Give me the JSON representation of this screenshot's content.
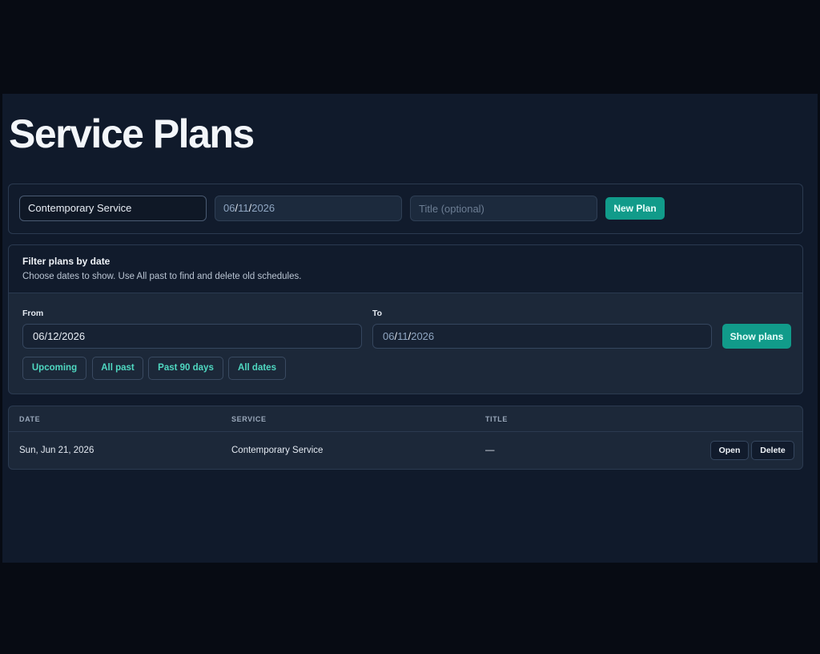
{
  "page": {
    "title": "Service Plans"
  },
  "create_bar": {
    "service_value": "Contemporary Service",
    "date": {
      "month": "06",
      "day": "11",
      "year": "2026"
    },
    "title_placeholder": "Title (optional)",
    "new_plan_label": "New Plan"
  },
  "filter": {
    "title": "Filter plans by date",
    "description": "Choose dates to show. Use All past to find and delete old schedules.",
    "from_label": "From",
    "from_value": "06/12/2026",
    "to_label": "To",
    "to_date": {
      "month": "06",
      "day": "11",
      "year": "2026"
    },
    "show_plans_label": "Show plans",
    "chips": [
      "Upcoming",
      "All past",
      "Past 90 days",
      "All dates"
    ]
  },
  "table": {
    "columns": [
      "DATE",
      "SERVICE",
      "TITLE"
    ],
    "rows": [
      {
        "date": "Sun, Jun 21, 2026",
        "service": "Contemporary Service",
        "title": "—",
        "open_label": "Open",
        "delete_label": "Delete"
      }
    ]
  },
  "colors": {
    "accent": "#119b8a",
    "chip_text": "#4fd8c1",
    "background": "#101a2b"
  }
}
